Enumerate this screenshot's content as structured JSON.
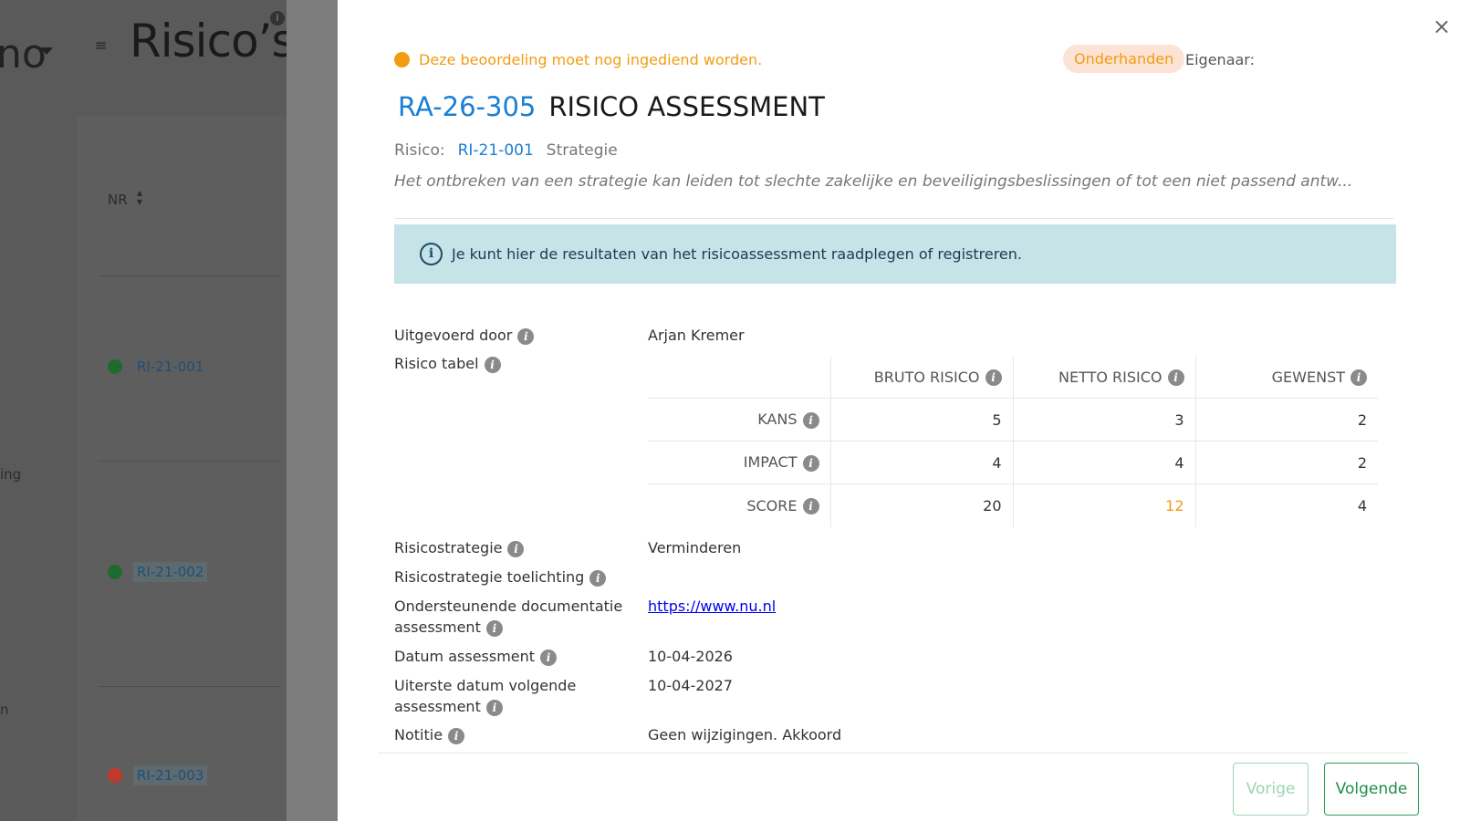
{
  "background": {
    "brand": "no",
    "page_title": "Risico’s",
    "column_header": "NR",
    "side_texts": [
      "ing",
      "n"
    ],
    "rows": [
      {
        "id": "RI-21-001",
        "status_color": "#1e6b2e"
      },
      {
        "id": "RI-21-002",
        "status_color": "#1e6b2e"
      },
      {
        "id": "RI-21-003",
        "status_color": "#c0392b"
      }
    ]
  },
  "modal": {
    "close_icon": "×",
    "status_message": "Deze beoordeling moet nog ingediend worden.",
    "state_badge": "Onderhanden",
    "owner_label": "Eigenaar:",
    "assessment_id": "RA-26-305",
    "assessment_title": "RISICO ASSESSMENT",
    "risk_label": "Risico:",
    "risk_id": "RI-21-001",
    "risk_name": "Strategie",
    "risk_description": "Het ontbreken van een strategie kan leiden tot slechte zakelijke en beveiligingsbeslissingen of tot een niet passend antw...",
    "info_message": "Je kunt hier de resultaten van het risicoassessment raadplegen of registreren.",
    "fields": {
      "performed_by_label": "Uitgevoerd door",
      "performed_by_value": "Arjan Kremer",
      "risk_table_label": "Risico tabel",
      "strategy_label": "Risicostrategie",
      "strategy_value": "Verminderen",
      "strategy_explanation_label": "Risicostrategie toelichting",
      "strategy_explanation_value": "",
      "documentation_label_line1": "Ondersteunende documentatie",
      "documentation_label_line2": "assessment",
      "documentation_value": "https://www.nu.nl",
      "date_label": "Datum assessment",
      "date_value": "10-04-2026",
      "next_date_label_line1": "Uiterste datum volgende",
      "next_date_label_line2": "assessment",
      "next_date_value": "10-04-2027",
      "note_label": "Notitie",
      "note_value": "Geen wijzigingen. Akkoord"
    },
    "risk_table": {
      "columns": [
        "BRUTO RISICO",
        "NETTO RISICO",
        "GEWENST"
      ],
      "rows": [
        {
          "label": "KANS",
          "values": [
            "5",
            "3",
            "2"
          ]
        },
        {
          "label": "IMPACT",
          "values": [
            "4",
            "4",
            "2"
          ]
        },
        {
          "label": "SCORE",
          "values": [
            "20",
            "12",
            "4"
          ]
        }
      ]
    },
    "buttons": {
      "previous": "Vorige",
      "next": "Volgende"
    },
    "colors": {
      "accent_blue": "#1a7fd4",
      "warning_orange": "#f39c12",
      "info_bg": "#c6e3e8",
      "success_green": "#1f8d4c"
    }
  }
}
